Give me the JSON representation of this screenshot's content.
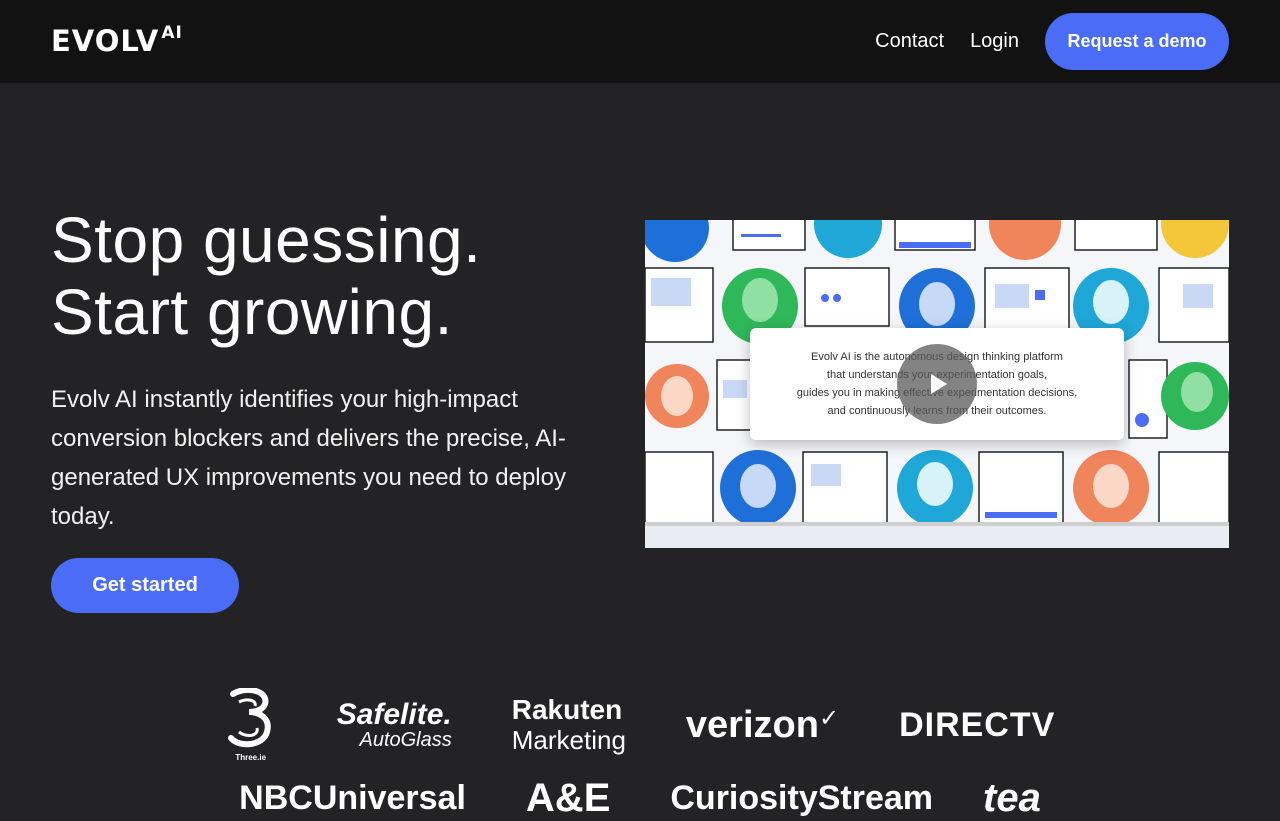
{
  "header": {
    "brand": "EVOLV",
    "brand_sup": "AI",
    "nav": {
      "contact": "Contact",
      "login": "Login"
    },
    "cta": "Request a demo"
  },
  "hero": {
    "title_line1": "Stop guessing.",
    "title_line2": "Start growing.",
    "description": "Evolv AI instantly identifies your high-impact conversion blockers and delivers the precise, AI-generated UX improvements you need to deploy today.",
    "cta": "Get started"
  },
  "video": {
    "caption_lines": [
      "Evolv AI is the autonomous design thinking platform",
      "that understands your experimentation goals,",
      "guides you in making effective experimentation decisions,",
      "and continuously learns from their outcomes."
    ],
    "play_icon": "play-icon"
  },
  "customers": {
    "row1": [
      "Three.ie",
      "Safelite AutoGlass",
      "Rakuten Marketing",
      "verizon",
      "DIRECTV"
    ],
    "row2": [
      "NBCUniversal",
      "A&E",
      "CuriosityStream",
      "tea"
    ]
  },
  "colors": {
    "accent": "#4a6cf7",
    "header_bg": "#121213",
    "page_bg": "#232325"
  }
}
